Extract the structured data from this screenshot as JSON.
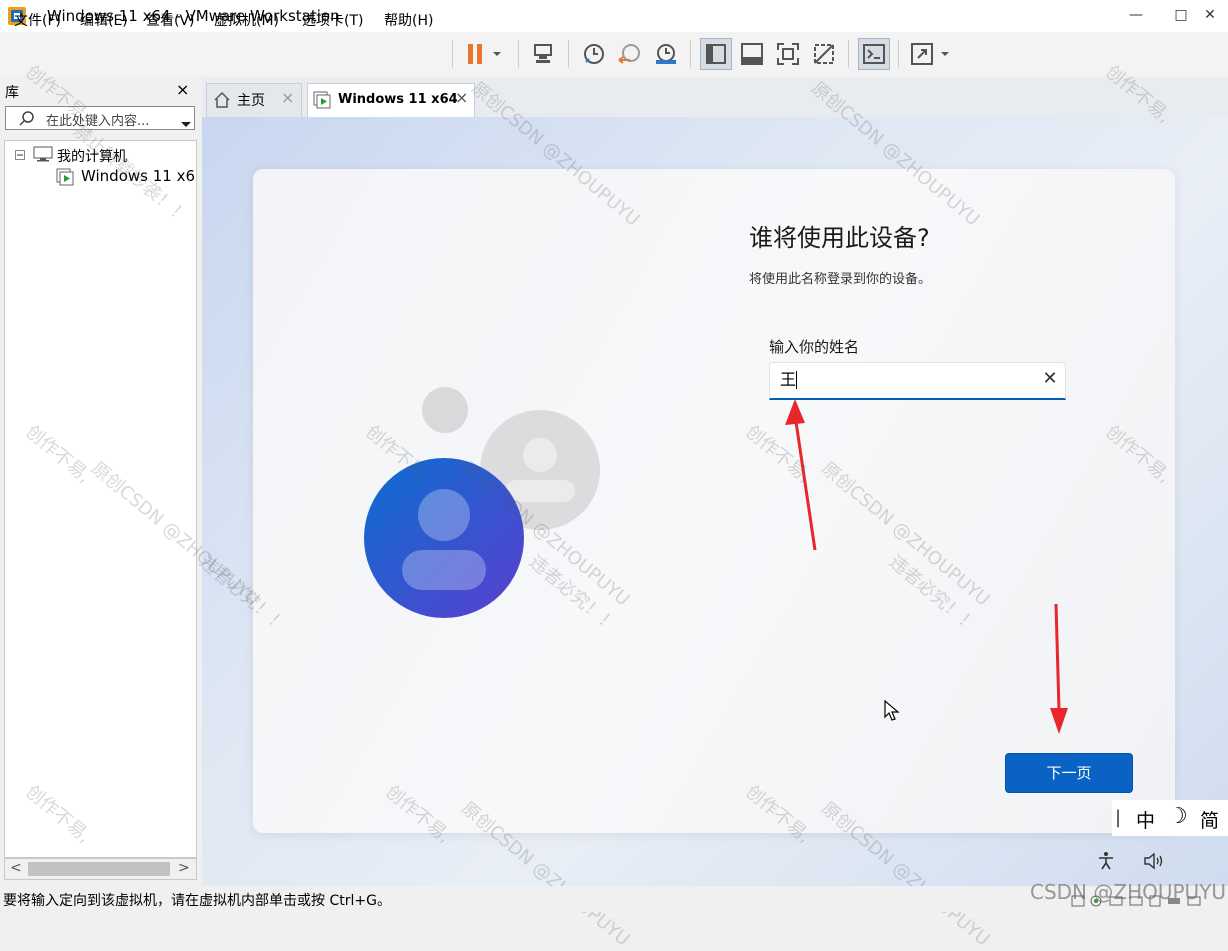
{
  "window": {
    "title": "Windows 11 x64 - VMware Workstation",
    "minimize": "—",
    "maximize": "□",
    "close": "✕"
  },
  "menu": {
    "items": [
      "文件(F)",
      "编辑(E)",
      "查看(V)",
      "虚拟机(M)",
      "选项卡(T)",
      "帮助(H)"
    ]
  },
  "library": {
    "title": "库",
    "close": "×",
    "search_placeholder": "在此处键入内容...",
    "tree": {
      "root": "我的计算机",
      "child": "Windows 11 x64"
    },
    "hscroll_left": "<",
    "hscroll_right": ">"
  },
  "tabs": [
    {
      "label": "主页",
      "close": "×"
    },
    {
      "label": "Windows 11 x64",
      "close": "×"
    }
  ],
  "oobe": {
    "heading": "谁将使用此设备?",
    "subtitle": "将使用此名称登录到你的设备。",
    "name_label": "输入你的姓名",
    "name_value": "王",
    "clear": "✕",
    "next_button": "下一页"
  },
  "ime": {
    "divider": "|",
    "mode": "中",
    "moon": "☽",
    "charset": "简"
  },
  "status_bar": {
    "message": "要将输入定向到该虚拟机，请在虚拟机内部单击或按 Ctrl+G。"
  },
  "watermark": {
    "text_a": "创作不易,",
    "text_b": "原创CSDN @ZHOUPUYU",
    "text_c": "禁止转载抄袭！！",
    "text_d": "违者必究！！",
    "footer": "CSDN @ZHOUPUYU"
  },
  "colors": {
    "accent": "#0a62c4",
    "pause_orange": "#e8762c",
    "annotation_red": "#e8262b"
  }
}
